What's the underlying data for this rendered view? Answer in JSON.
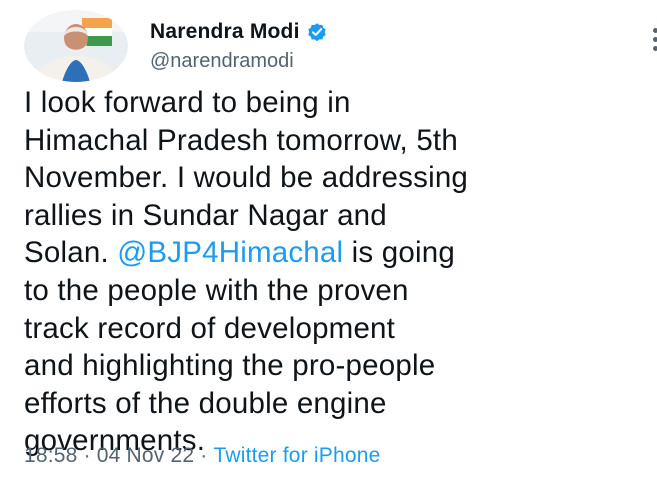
{
  "author": {
    "display_name": "Narendra Modi",
    "handle": "@narendramodi",
    "verified": true
  },
  "tweet": {
    "lines": [
      [
        {
          "text": "I look forward to being in"
        }
      ],
      [
        {
          "text": "Himachal Pradesh tomorrow, 5th"
        }
      ],
      [
        {
          "text": "November. I would be addressing"
        }
      ],
      [
        {
          "text": "rallies in Sundar Nagar and"
        }
      ],
      [
        {
          "text": "Solan. "
        },
        {
          "text": "@BJP4Himachal",
          "mention": true
        },
        {
          "text": " is going"
        }
      ],
      [
        {
          "text": "to the people with the proven"
        }
      ],
      [
        {
          "text": "track record of development"
        }
      ],
      [
        {
          "text": "and highlighting the pro-people"
        }
      ],
      [
        {
          "text": "efforts of the double engine"
        }
      ],
      [
        {
          "text": "governments."
        }
      ]
    ]
  },
  "meta": {
    "time": "18:58",
    "separator": "·",
    "date": "04 Nov 22",
    "source": "Twitter for iPhone"
  },
  "colors": {
    "text": "#0f1419",
    "secondary": "#536471",
    "link": "#1d9bf0",
    "verified": "#1d9bf0"
  },
  "icons": {
    "verified": "verified-badge-icon",
    "more": "more-options-icon"
  }
}
